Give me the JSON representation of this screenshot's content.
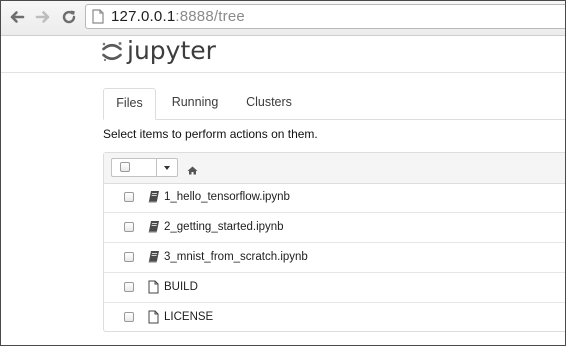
{
  "browser": {
    "url_host": "127.0.0.1",
    "url_rest": ":8888/tree"
  },
  "header": {
    "logo_text": "jupyter"
  },
  "tabs": [
    {
      "label": "Files",
      "active": true
    },
    {
      "label": "Running",
      "active": false
    },
    {
      "label": "Clusters",
      "active": false
    }
  ],
  "instructions": "Select items to perform actions on them.",
  "file_list": {
    "items": [
      {
        "name": "1_hello_tensorflow.ipynb",
        "type": "notebook",
        "icon": "notebook-icon"
      },
      {
        "name": "2_getting_started.ipynb",
        "type": "notebook",
        "icon": "notebook-icon"
      },
      {
        "name": "3_mnist_from_scratch.ipynb",
        "type": "notebook",
        "icon": "notebook-icon"
      },
      {
        "name": "BUILD",
        "type": "file",
        "icon": "file-icon"
      },
      {
        "name": "LICENSE",
        "type": "file",
        "icon": "file-icon"
      }
    ]
  },
  "colors": {
    "jupyter_orange": "#f37726",
    "text": "#1e1e1e",
    "border": "#dddddd"
  }
}
